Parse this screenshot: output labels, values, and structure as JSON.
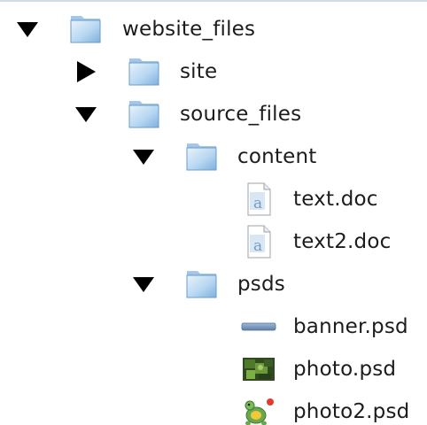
{
  "tree": {
    "root": {
      "label": "website_files",
      "expanded": true,
      "icon": "folder-icon",
      "children": {
        "site": {
          "label": "site",
          "expanded": false,
          "icon": "folder-icon"
        },
        "source_files": {
          "label": "source_files",
          "expanded": true,
          "icon": "folder-icon",
          "children": {
            "content": {
              "label": "content",
              "expanded": true,
              "icon": "folder-icon",
              "files": [
                {
                  "label": "text.doc",
                  "icon": "text-document-icon"
                },
                {
                  "label": "text2.doc",
                  "icon": "text-document-icon"
                }
              ]
            },
            "psds": {
              "label": "psds",
              "expanded": true,
              "icon": "folder-icon",
              "files": [
                {
                  "label": "banner.psd",
                  "icon": "banner-thumbnail-icon"
                },
                {
                  "label": "photo.psd",
                  "icon": "photo-thumbnail-icon"
                },
                {
                  "label": "photo2.psd",
                  "icon": "turtle-thumbnail-icon"
                }
              ]
            }
          }
        }
      }
    }
  },
  "colors": {
    "text": "#1c1c1c",
    "folder_light": "#cfe4f6",
    "folder_dark": "#6a9ccb",
    "disclosure": "#000000"
  }
}
